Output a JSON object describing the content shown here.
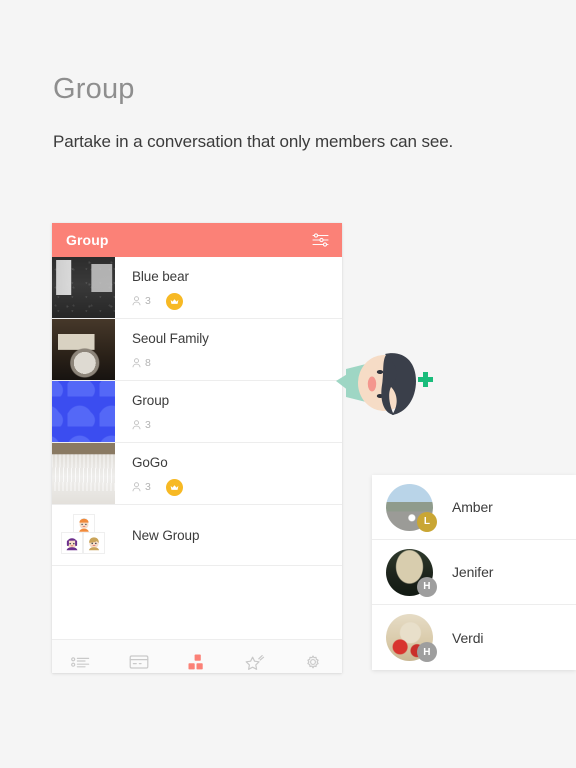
{
  "page": {
    "title": "Group",
    "subtitle": "Partake in a conversation that only members can see."
  },
  "colors": {
    "header_coral": "#FB8177",
    "accent_coral": "#FB8177",
    "crown_gold": "#F7B924",
    "badge_gold": "#C9A634",
    "badge_gray": "#9E9E9E",
    "page_background": "#F5F5F5",
    "illustration_green": "#1ABC7B",
    "illustration_teal": "#9ED6C4",
    "illustration_hair": "#3A3F4A",
    "illustration_skin": "#F6DCC6"
  },
  "app": {
    "header": {
      "title": "Group",
      "filter_icon": "sliders-filter-icon"
    },
    "groups": [
      {
        "name": "Blue bear",
        "member_icon": "person-icon",
        "member_count": "3",
        "has_crown": true,
        "crown_icon": "crown-icon",
        "thumb": "train-window-photo"
      },
      {
        "name": "Seoul Family",
        "member_icon": "person-icon",
        "member_count": "8",
        "has_crown": false,
        "crown_icon": "",
        "thumb": "vintage-camera-photo"
      },
      {
        "name": "Group",
        "member_icon": "person-icon",
        "member_count": "3",
        "has_crown": false,
        "crown_icon": "",
        "thumb": "blue-cloud-pattern"
      },
      {
        "name": "GoGo",
        "member_icon": "person-icon",
        "member_count": "3",
        "has_crown": true,
        "crown_icon": "crown-icon",
        "thumb": "interior-room-photo"
      }
    ],
    "new_group": {
      "label": "New Group",
      "avatars": [
        "nurse-character-avatar",
        "purple-hair-character-avatar",
        "blond-boy-character-avatar"
      ]
    },
    "tabs": [
      {
        "name": "list",
        "icon": "bullet-list-icon",
        "active": false
      },
      {
        "name": "card",
        "icon": "card-window-icon",
        "active": false
      },
      {
        "name": "groups",
        "icon": "blocks-icon",
        "active": true
      },
      {
        "name": "favorite",
        "icon": "star-sparkle-icon",
        "active": false
      },
      {
        "name": "settings",
        "icon": "gear-icon",
        "active": false
      }
    ]
  },
  "illustration": {
    "name": "profile-face-plus-illustration",
    "plus_icon": "plus-icon"
  },
  "contacts": [
    {
      "name": "Amber",
      "badge": "L",
      "badge_color": "#C9A634",
      "avatar": "street-photo-avatar"
    },
    {
      "name": "Jenifer",
      "badge": "H",
      "badge_color": "#9E9E9E",
      "avatar": "hat-portrait-avatar"
    },
    {
      "name": "Verdi",
      "badge": "H",
      "badge_color": "#9E9E9E",
      "avatar": "strawberry-waffle-avatar"
    }
  ]
}
